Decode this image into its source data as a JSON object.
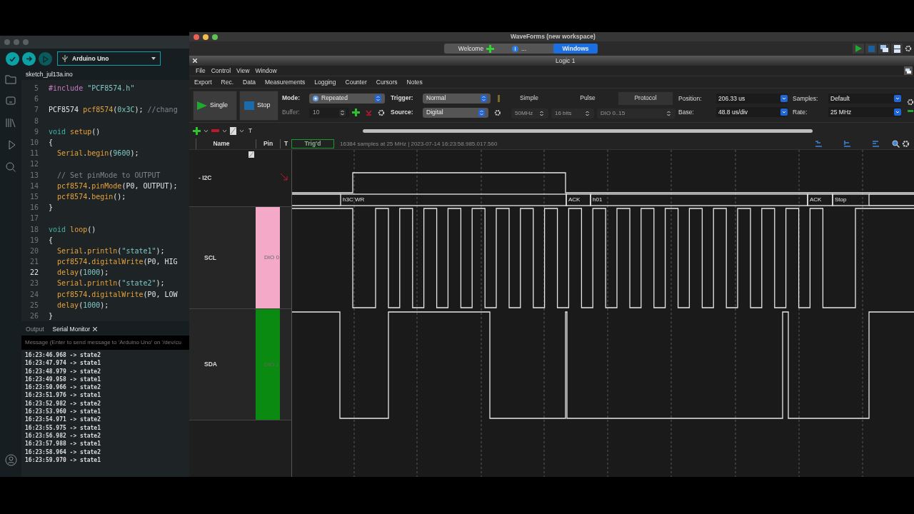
{
  "arduino": {
    "board": "Arduino Uno",
    "file_tab": "sketch_jul13a.ino",
    "code_lines": [
      {
        "number": "5",
        "current": false,
        "tokens": [
          {
            "text": "#include ",
            "kind": "pre"
          },
          {
            "text": "\"PCF8574.h\"",
            "kind": "str"
          }
        ]
      },
      {
        "number": "6",
        "current": false
      },
      {
        "number": "7",
        "current": false,
        "tokens": [
          {
            "text": "PCF8574 ",
            "kind": "plain"
          },
          {
            "text": "pcf8574",
            "kind": "obj"
          },
          {
            "text": "(",
            "kind": "plain"
          },
          {
            "text": "0x3C",
            "kind": "num"
          },
          {
            "text": "); ",
            "kind": "plain"
          },
          {
            "text": "//chang",
            "kind": "cmt"
          }
        ]
      },
      {
        "number": "8",
        "current": false
      },
      {
        "number": "9",
        "current": false,
        "tokens": [
          {
            "text": "void ",
            "kind": "kw"
          },
          {
            "text": "setup",
            "kind": "obj"
          },
          {
            "text": "()",
            "kind": "plain"
          }
        ]
      },
      {
        "number": "10",
        "current": false,
        "tokens": [
          {
            "text": "{",
            "kind": "plain"
          }
        ]
      },
      {
        "number": "11",
        "current": false,
        "tokens": [
          {
            "text": "  Serial",
            "kind": "obj"
          },
          {
            "text": ".",
            "kind": "plain"
          },
          {
            "text": "begin",
            "kind": "obj"
          },
          {
            "text": "(",
            "kind": "plain"
          },
          {
            "text": "9600",
            "kind": "num"
          },
          {
            "text": ");",
            "kind": "plain"
          }
        ]
      },
      {
        "number": "12",
        "current": false
      },
      {
        "number": "13",
        "current": false,
        "tokens": [
          {
            "text": "  // Set pinMode to OUTPUT",
            "kind": "cmt"
          }
        ]
      },
      {
        "number": "14",
        "current": false,
        "tokens": [
          {
            "text": "  pcf8574",
            "kind": "obj"
          },
          {
            "text": ".",
            "kind": "plain"
          },
          {
            "text": "pinMode",
            "kind": "obj"
          },
          {
            "text": "(P0, OUTPUT);",
            "kind": "plain"
          }
        ]
      },
      {
        "number": "15",
        "current": false,
        "tokens": [
          {
            "text": "  pcf8574",
            "kind": "obj"
          },
          {
            "text": ".",
            "kind": "plain"
          },
          {
            "text": "begin",
            "kind": "obj"
          },
          {
            "text": "();",
            "kind": "plain"
          }
        ]
      },
      {
        "number": "16",
        "current": false,
        "tokens": [
          {
            "text": "}",
            "kind": "plain"
          }
        ]
      },
      {
        "number": "17",
        "current": false
      },
      {
        "number": "18",
        "current": false,
        "tokens": [
          {
            "text": "void ",
            "kind": "kw"
          },
          {
            "text": "loop",
            "kind": "obj"
          },
          {
            "text": "()",
            "kind": "plain"
          }
        ]
      },
      {
        "number": "19",
        "current": false,
        "tokens": [
          {
            "text": "{",
            "kind": "plain"
          }
        ]
      },
      {
        "number": "20",
        "current": false,
        "tokens": [
          {
            "text": "  Serial",
            "kind": "obj"
          },
          {
            "text": ".",
            "kind": "plain"
          },
          {
            "text": "println",
            "kind": "obj"
          },
          {
            "text": "(",
            "kind": "plain"
          },
          {
            "text": "\"state1\"",
            "kind": "str"
          },
          {
            "text": ");",
            "kind": "plain"
          }
        ]
      },
      {
        "number": "21",
        "current": false,
        "tokens": [
          {
            "text": "  pcf8574",
            "kind": "obj"
          },
          {
            "text": ".",
            "kind": "plain"
          },
          {
            "text": "digitalWrite",
            "kind": "obj"
          },
          {
            "text": "(P0, HIG",
            "kind": "plain"
          }
        ]
      },
      {
        "number": "22",
        "current": true,
        "tokens": [
          {
            "text": "  delay",
            "kind": "obj"
          },
          {
            "text": "(",
            "kind": "plain"
          },
          {
            "text": "1000",
            "kind": "num"
          },
          {
            "text": ");",
            "kind": "plain"
          }
        ]
      },
      {
        "number": "23",
        "current": false,
        "tokens": [
          {
            "text": "  Serial",
            "kind": "obj"
          },
          {
            "text": ".",
            "kind": "plain"
          },
          {
            "text": "println",
            "kind": "obj"
          },
          {
            "text": "(",
            "kind": "plain"
          },
          {
            "text": "\"state2\"",
            "kind": "str"
          },
          {
            "text": ");",
            "kind": "plain"
          }
        ]
      },
      {
        "number": "24",
        "current": false,
        "tokens": [
          {
            "text": "  pcf8574",
            "kind": "obj"
          },
          {
            "text": ".",
            "kind": "plain"
          },
          {
            "text": "digitalWrite",
            "kind": "obj"
          },
          {
            "text": "(P0, LOW",
            "kind": "plain"
          }
        ]
      },
      {
        "number": "25",
        "current": false,
        "tokens": [
          {
            "text": "  delay",
            "kind": "obj"
          },
          {
            "text": "(",
            "kind": "plain"
          },
          {
            "text": "1000",
            "kind": "num"
          },
          {
            "text": ");",
            "kind": "plain"
          }
        ]
      },
      {
        "number": "26",
        "current": false,
        "tokens": [
          {
            "text": "}",
            "kind": "plain"
          }
        ]
      }
    ],
    "bottom_tabs": [
      {
        "label": "Output",
        "selected": false
      },
      {
        "label": "Serial Monitor",
        "selected": true
      }
    ],
    "message_placeholder": "Message (Enter to send message to 'Arduino Uno' on '/dev/cu",
    "serial_lines": [
      "16:23:46.968 -> state2",
      "16:23:47.974 -> state1",
      "16:23:48.979 -> state2",
      "16:23:49.958 -> state1",
      "16:23:50.966 -> state2",
      "16:23:51.976 -> state1",
      "16:23:52.982 -> state2",
      "16:23:53.960 -> state1",
      "16:23:54.971 -> state2",
      "16:23:55.975 -> state1",
      "16:23:56.982 -> state2",
      "16:23:57.988 -> state1",
      "16:23:58.964 -> state2",
      "16:23:59.970 -> state1"
    ]
  },
  "waveforms": {
    "title": "WaveForms (new workspace)",
    "tabs": [
      {
        "label": "Welcome",
        "selected": false
      },
      {
        "label": "...",
        "selected": false
      },
      {
        "label": "Windows",
        "selected": true
      }
    ],
    "window_title": "Logic 1",
    "menu": [
      "File",
      "Control",
      "View",
      "Window"
    ],
    "toolbar": [
      "Export",
      "Rec.",
      "Data",
      "Measurements",
      "Logging",
      "Counter",
      "Cursors",
      "Notes"
    ],
    "buttons": [
      "Single",
      "Stop"
    ],
    "mode": {
      "label": "Mode:",
      "value": "Repeated"
    },
    "buffer": {
      "label": "Buffer:",
      "value": "10",
      "disabled": true
    },
    "trigger": {
      "label": "Trigger:",
      "value": "Normal"
    },
    "source": {
      "label": "Source:",
      "value": "Digital"
    },
    "trigger_tabs": [
      {
        "label": "Simple",
        "selected": false
      },
      {
        "label": "Pulse",
        "selected": false
      },
      {
        "label": "Protocol",
        "selected": true
      }
    ],
    "fields": [
      {
        "value": "50MHz",
        "disabled": true
      },
      {
        "value": "16 bits",
        "disabled": true
      },
      {
        "value": "DIO 0..15",
        "disabled": true
      }
    ],
    "settings": [
      {
        "label": "Position:",
        "value": "206.33 us"
      },
      {
        "label": "Base:",
        "value": "48.8 us/div"
      },
      {
        "label": "Samples:",
        "value": "Default"
      },
      {
        "label": "Rate:",
        "value": "25 MHz"
      }
    ],
    "toolbar_t": "T",
    "columns": [
      "Name",
      "Pin",
      "T"
    ],
    "trigger_status": "Trig'd",
    "capture_info": "16384 samples at 25 MHz | 2023-07-14 16:23:58.985.017.560",
    "channels": [
      {
        "kind": "bus",
        "name": "- I2C"
      },
      {
        "kind": "signal",
        "name": "SCL",
        "pin": "DIO 0",
        "color": "#f4a9c8"
      },
      {
        "kind": "signal",
        "name": "SDA",
        "pin": "DIO 1",
        "color": "#0b8a12"
      }
    ],
    "decoded": [
      "h3C WR",
      "ACK",
      "h01",
      "ACK",
      "Stop"
    ]
  }
}
